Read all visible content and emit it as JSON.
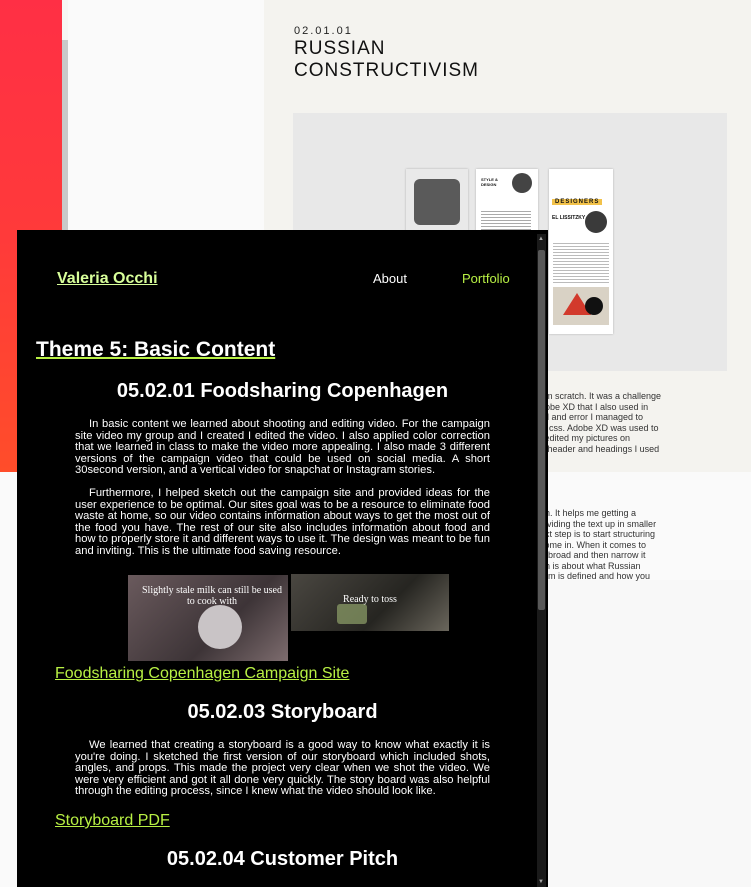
{
  "background_page": {
    "section_number": "02.01.01",
    "section_title": "RUSSIAN CONSTRUCTIVISM",
    "thumb_style_heading": "STYLE & DESIGN",
    "thumb_designers_heading": "DESIGNERS",
    "thumb_designer_name": "EL LISSITZKY",
    "text_fragments_1": [
      "om scratch. It was a challenge",
      "dobe XD that I also used in",
      "ial and error I managed to",
      "D css. Adobe XD was used to",
      "l edited my pictures on",
      "e header and headings I used"
    ],
    "text_fragments_2": [
      "gh. It helps me getting a",
      "dividing the text up in smaller",
      "ext step is to start structuring",
      "come in. When it comes to",
      "rt broad and then narrow it",
      "ph is about what Russian",
      "orm is defined and how you"
    ]
  },
  "window": {
    "brand": "Valeria Occhi",
    "nav": {
      "about": "About",
      "portfolio": "Portfolio"
    },
    "theme_title": "Theme 5: Basic Content",
    "section1": {
      "title": "05.02.01 Foodsharing Copenhagen",
      "paragraphs": [
        "In basic content we learned about shooting and editing video. For the campaign site video my group and I created I edited the video. I also applied color correction that we learned in class to make the video more appealing. I also made 3 different versions of the campaign video that could be used on social media. A short 30second version, and a vertical video for snapchat or Instagram stories.",
        "Furthermore, I helped sketch out the campaign site and provided ideas for the user experience to be optimal. Our sites goal was to be a resource to eliminate food waste at home, so our video contains information about ways to get the most out of the food you have. The rest of our site also includes information about food and how to properly store it and different ways to use it. The design was meant to be fun and inviting. This is the ultimate food saving resource."
      ],
      "video1_caption": "Slightly stale milk can still be used to cook with",
      "video2_caption": "Ready to toss",
      "link": "Foodsharing Copenhagen Campaign Site"
    },
    "section2": {
      "title": "05.02.03 Storyboard",
      "paragraph": "We learned that creating a storyboard is a good way to know what exactly it is you're doing. I sketched the first version of our storyboard which included shots, angles, and props. This made the project very clear when we shot the video. We were very efficient and got it all done very quickly. The story board was also helpful through the editing process, since I knew what the video should look like.",
      "link": "Storyboard PDF"
    },
    "section3": {
      "title": "05.02.04 Customer Pitch"
    }
  },
  "colors": {
    "accent_green": "#b8f044",
    "brand_green": "#d8ff9a",
    "gradient_red": "#ff2f45"
  }
}
